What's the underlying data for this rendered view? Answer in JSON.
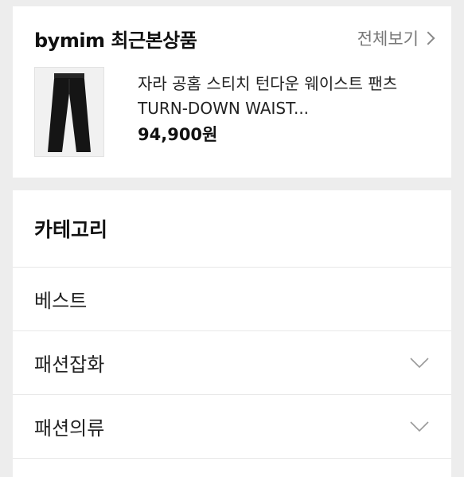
{
  "recent": {
    "title": "bymim 최근본상품",
    "view_all_label": "전체보기",
    "product": {
      "name": "자라 공홈 스티치 턴다운 웨이스트 팬츠 TURN-DOWN WAIST...",
      "price": "94,900원"
    }
  },
  "categories": {
    "title": "카테고리",
    "items": [
      {
        "label": "베스트",
        "expandable": false
      },
      {
        "label": "패션잡화",
        "expandable": true
      },
      {
        "label": "패션의류",
        "expandable": true
      }
    ]
  }
}
